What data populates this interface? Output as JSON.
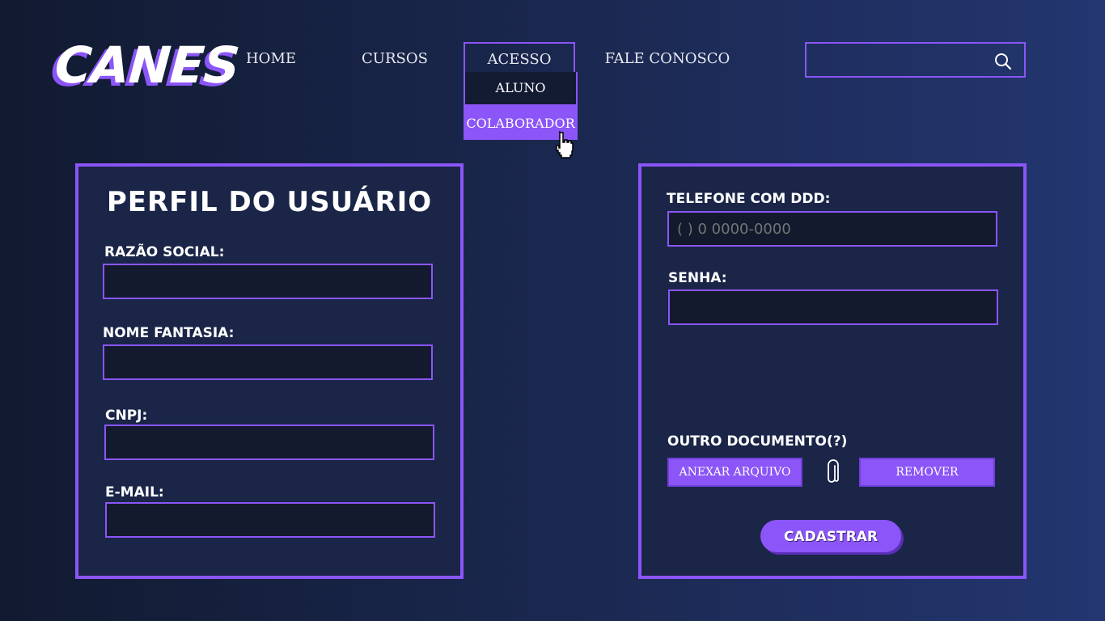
{
  "brand": {
    "logo_text": "CANES"
  },
  "nav": {
    "home": "HOME",
    "cursos": "CURSOS",
    "acesso": "ACESSO",
    "fale": "FALE CONOSCO",
    "dropdown": {
      "aluno": "ALUNO",
      "colaborador": "COLABORADOR"
    }
  },
  "search": {
    "placeholder": "",
    "icon": "search-icon"
  },
  "left_panel": {
    "title": "PERFIL DO USUÁRIO",
    "fields": {
      "razao_social": {
        "label": "RAZÃO SOCIAL:",
        "value": ""
      },
      "nome_fantasia": {
        "label": "NOME FANTASIA:",
        "value": ""
      },
      "cnpj": {
        "label": "CNPJ:",
        "value": ""
      },
      "email": {
        "label": "E-MAIL:",
        "value": ""
      }
    }
  },
  "right_panel": {
    "telefone": {
      "label": "TELEFONE  COM DDD:",
      "placeholder": "( ) 0 0000-0000"
    },
    "senha": {
      "label": "SENHA:",
      "value": ""
    },
    "documento": {
      "label": "OUTRO DOCUMENTO(?)",
      "anexar": "ANEXAR ARQUIVO",
      "remover": "REMOVER",
      "icon": "paperclip-icon"
    },
    "cadastrar": "CADASTRAR"
  },
  "colors": {
    "accent": "#8b55f7",
    "field_bg": "#131a2e",
    "panel_bg": "#1a2548"
  }
}
